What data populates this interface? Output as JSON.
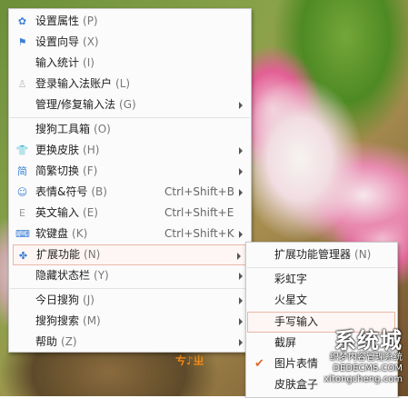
{
  "main_menu": {
    "items": [
      {
        "label": "设置属性",
        "key": "(P)",
        "icon": "gear-icon"
      },
      {
        "label": "设置向导",
        "key": "(X)",
        "icon": "flag-icon"
      },
      {
        "label": "输入统计",
        "key": "(I)",
        "icon": ""
      },
      {
        "label": "登录输入法账户",
        "key": "(L)",
        "icon": "user-icon"
      },
      {
        "label": "管理/修复输入法",
        "key": "(G)",
        "icon": ""
      },
      {
        "label": "搜狗工具箱",
        "key": "(O)",
        "icon": ""
      },
      {
        "label": "更换皮肤",
        "key": "(H)",
        "icon": "shirt-icon"
      },
      {
        "label": "简繁切换",
        "key": "(F)",
        "icon": "jian-fan-icon"
      },
      {
        "label": "表情&符号",
        "key": "(B)",
        "icon": "smiley-icon",
        "shortcut": "Ctrl+Shift+B"
      },
      {
        "label": "英文输入",
        "key": "(E)",
        "icon": "english-icon",
        "shortcut": "Ctrl+Shift+E"
      },
      {
        "label": "软键盘",
        "key": "(K)",
        "icon": "keyboard-icon",
        "shortcut": "Ctrl+Shift+K"
      },
      {
        "label": "扩展功能",
        "key": "(N)",
        "icon": "puzzle-icon"
      },
      {
        "label": "隐藏状态栏",
        "key": "(Y)",
        "icon": ""
      },
      {
        "label": "今日搜狗",
        "key": "(J)",
        "icon": ""
      },
      {
        "label": "搜狗搜索",
        "key": "(M)",
        "icon": ""
      },
      {
        "label": "帮助",
        "key": "(Z)",
        "icon": ""
      }
    ]
  },
  "sub_menu": {
    "items": [
      {
        "label": "扩展功能管理器",
        "key": "(N)"
      },
      {
        "label": "彩虹字",
        "key": ""
      },
      {
        "label": "火星文",
        "key": ""
      },
      {
        "label": "手写输入",
        "key": ""
      },
      {
        "label": "截屏",
        "key": ""
      },
      {
        "label": "图片表情",
        "key": ""
      },
      {
        "label": "皮肤盒子",
        "key": ""
      }
    ]
  },
  "watermark": {
    "big": "系统城",
    "line1": "织梦内容管理系统",
    "line2": "DEDECMS.COM",
    "line3": "xitongcheng.com"
  },
  "sticker": "ㄘ♪ㄓ",
  "colors": {
    "accent": "#3b7fd6",
    "highlight_border": "#e9b7a8",
    "check": "#e26a2a"
  }
}
